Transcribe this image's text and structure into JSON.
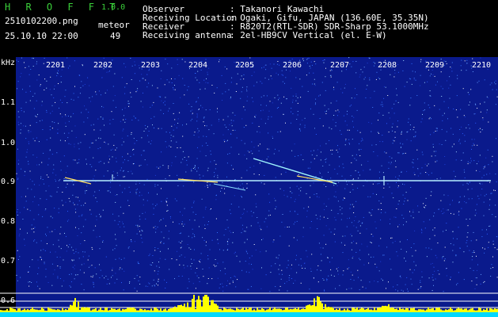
{
  "header": {
    "app_title": "H R O F F T",
    "version": "1.0.0",
    "filename": "2510102200.png",
    "datetime": "25.10.10 22:00",
    "meteor_label": "meteor",
    "meteor_count": "49",
    "info": [
      {
        "label": "Observer",
        "value": ": Takanori Kawachi"
      },
      {
        "label": "Receiving Location",
        "value": ": Ogaki, Gifu, JAPAN (136.60E, 35.35N)"
      },
      {
        "label": "Receiver",
        "value": ": R820T2(RTL-SDR) SDR-Sharp 53.1000MHz"
      },
      {
        "label": "Receiving antenna",
        "value": ": 2el-HB9CV Vertical (el. E-W)"
      }
    ]
  },
  "axes": {
    "y_unit": "kHz",
    "y_ticks": [
      "1.1",
      "1.0",
      "0.9",
      "0.8",
      "0.7",
      "0.6"
    ],
    "x_ticks": [
      "2201",
      "2202",
      "2203",
      "2204",
      "2205",
      "2206",
      "2207",
      "2208",
      "2209",
      "2210"
    ]
  },
  "colors": {
    "background": "#0a1a8c",
    "carrier": "#b8f0ff",
    "histogram": "#ffff00",
    "baseline": "#00d8ff"
  }
}
